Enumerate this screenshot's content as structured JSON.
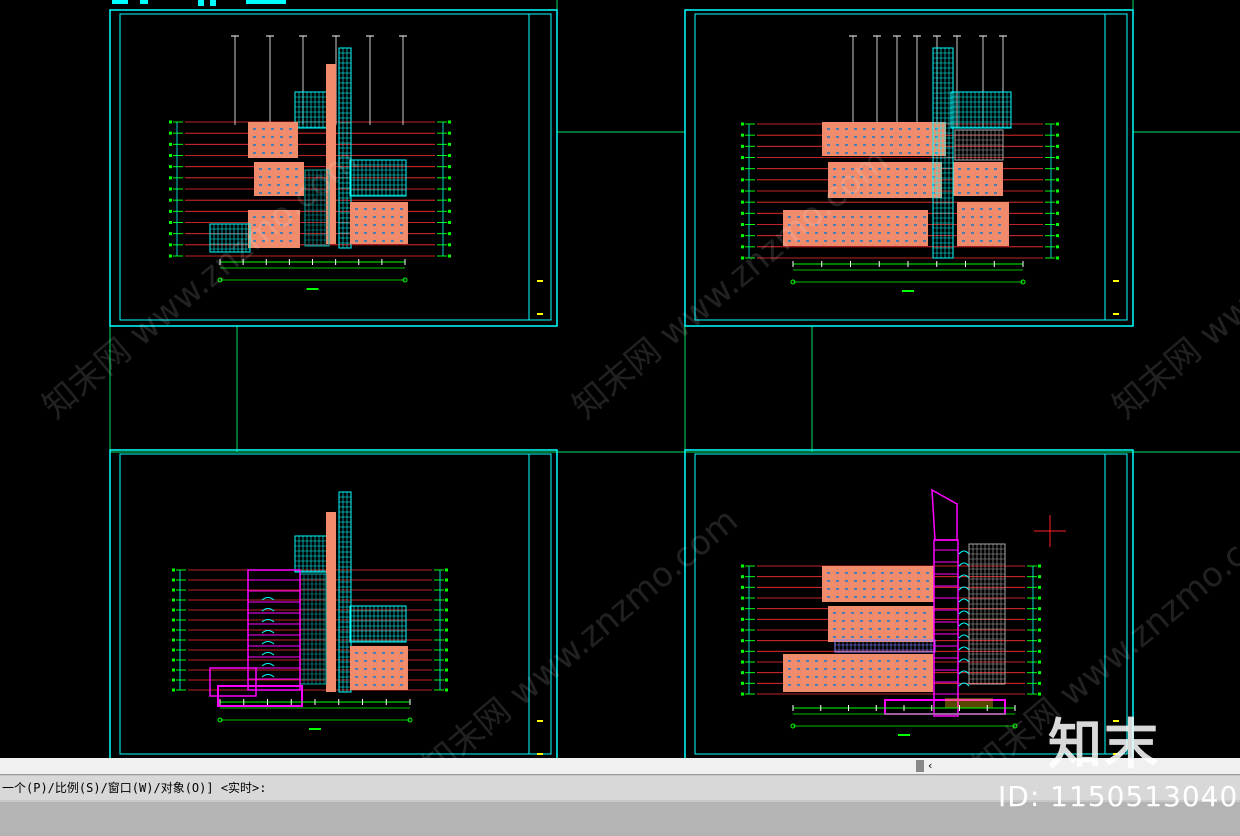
{
  "command_line": {
    "prompt_text": "一个(P)/比例(S)/窗口(W)/对象(O)] <实时>:",
    "scroll_arrow": "‹"
  },
  "watermark": {
    "logo_text": "知末",
    "id_text": "ID: 1150513040",
    "site_text": "知末网 www.znzmo.com"
  },
  "colors": {
    "background": "#000000",
    "frame": "#00ffff",
    "facade_panel": "#f08c6c",
    "level_line": "#ff3030",
    "dimension": "#00ff00",
    "section": "#ff00ff",
    "cursor": "#ff2020"
  },
  "sheets": [
    {
      "id": "elevation-1",
      "variant": "front"
    },
    {
      "id": "elevation-2",
      "variant": "back"
    },
    {
      "id": "section-1",
      "variant": "section-left"
    },
    {
      "id": "section-2",
      "variant": "section-right"
    }
  ]
}
